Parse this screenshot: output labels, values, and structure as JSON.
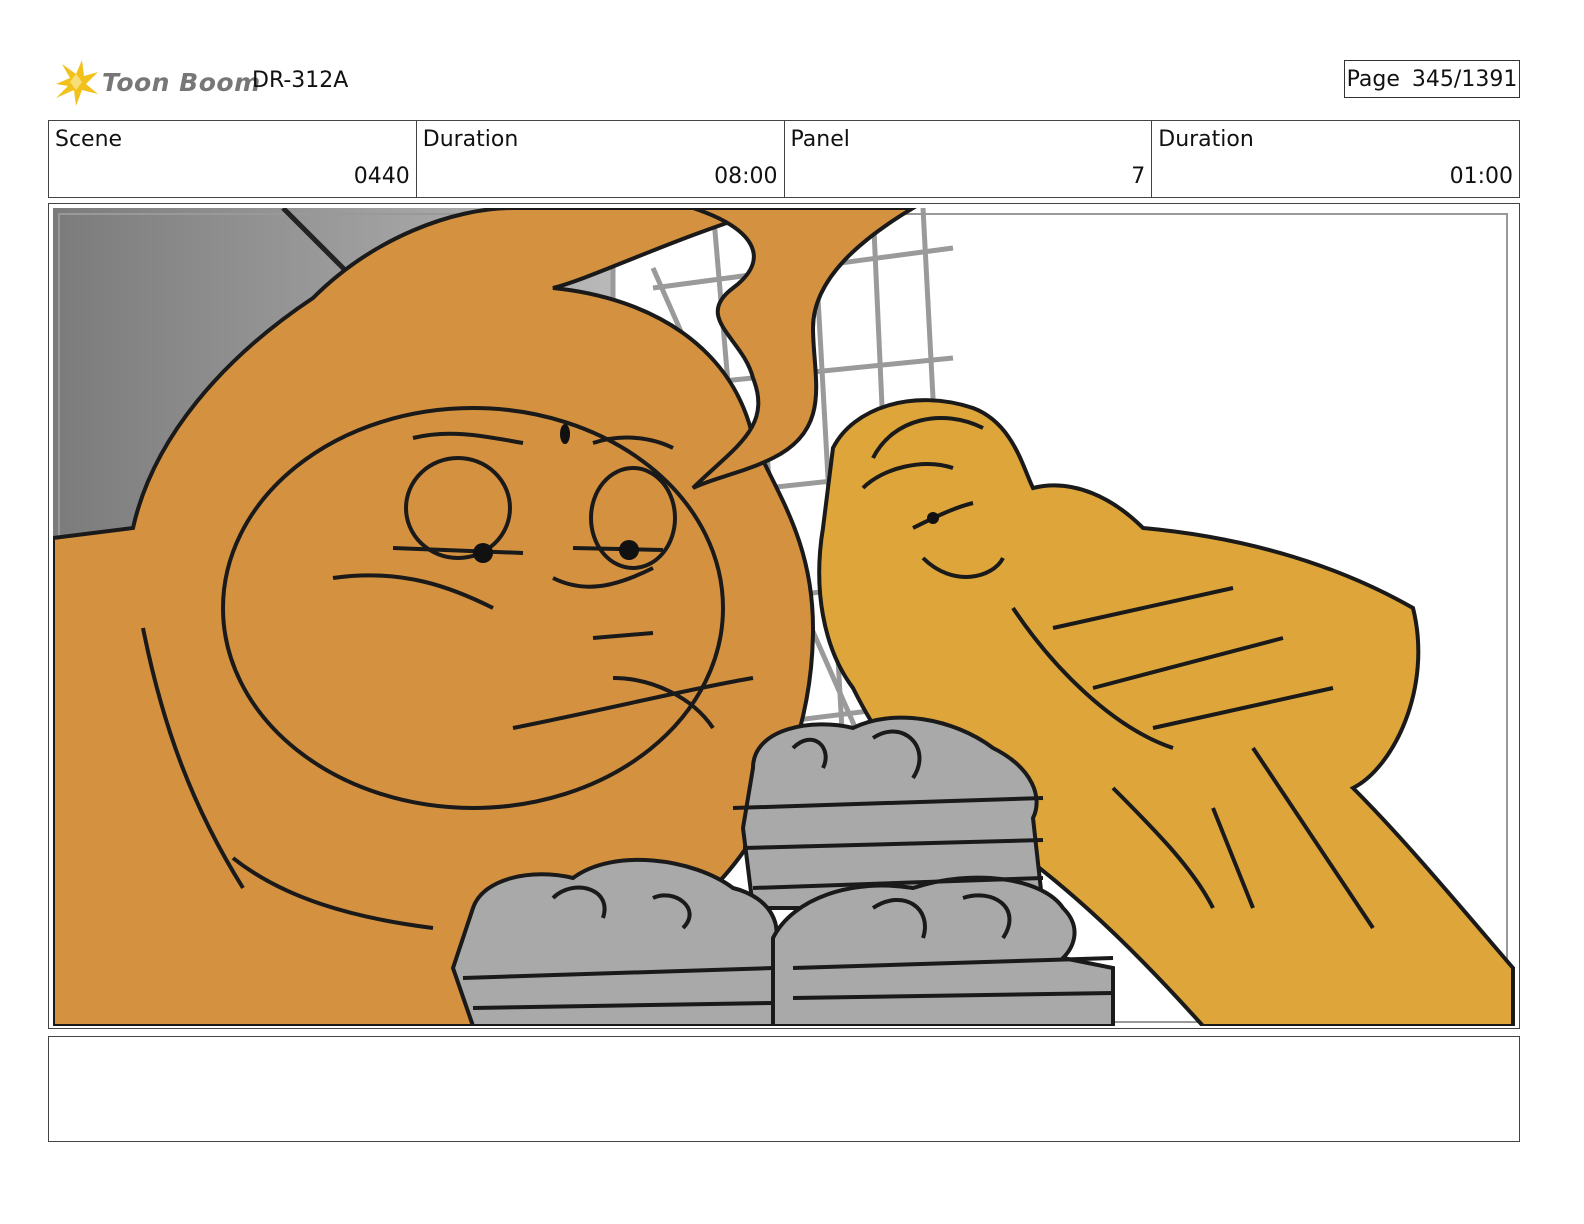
{
  "header": {
    "logo_text": "Toon Boom",
    "episode_code": "DR-312A",
    "page_label": "Page",
    "page_number": "345/1391"
  },
  "info": {
    "scene_label": "Scene",
    "scene_value": "0440",
    "scene_duration_label": "Duration",
    "scene_duration_value": "08:00",
    "panel_label": "Panel",
    "panel_value": "7",
    "panel_duration_label": "Duration",
    "panel_duration_value": "01:00"
  },
  "notes": {
    "text": ""
  },
  "colors": {
    "orange_character": "#d4913f",
    "yellow_character": "#dea63a",
    "gray_bowls": "#a9a9a9",
    "background_gray": "#8a8a8a",
    "logo_yellow": "#f3c11b"
  }
}
